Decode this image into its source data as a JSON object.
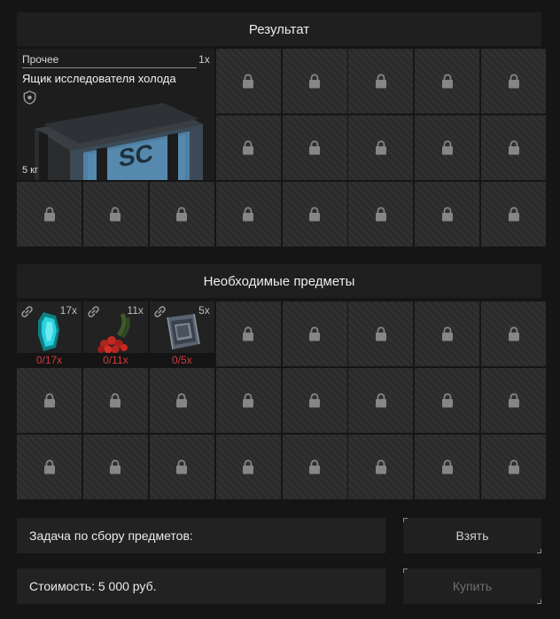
{
  "result": {
    "title": "Результат",
    "item": {
      "category": "Прочее",
      "quantity": "1x",
      "name": "Ящик исследователя холода",
      "weight": "5 кг",
      "icon": "crate-icon"
    }
  },
  "required": {
    "title": "Необходимые предметы",
    "items": [
      {
        "quantity": "17x",
        "count": "0/17x",
        "icon": "crystal-icon"
      },
      {
        "quantity": "11x",
        "count": "0/11x",
        "icon": "berries-icon"
      },
      {
        "quantity": "5x",
        "count": "0/5x",
        "icon": "armor-plate-icon"
      }
    ]
  },
  "task": {
    "label": "Задача по сбору предметов:"
  },
  "cost": {
    "label": "Стоимость: 5 000  руб."
  },
  "buttons": {
    "take": "Взять",
    "buy": "Купить"
  },
  "colors": {
    "missing_count": "#d23b3b",
    "background": "#151515",
    "panel": "#1f1f1f"
  }
}
